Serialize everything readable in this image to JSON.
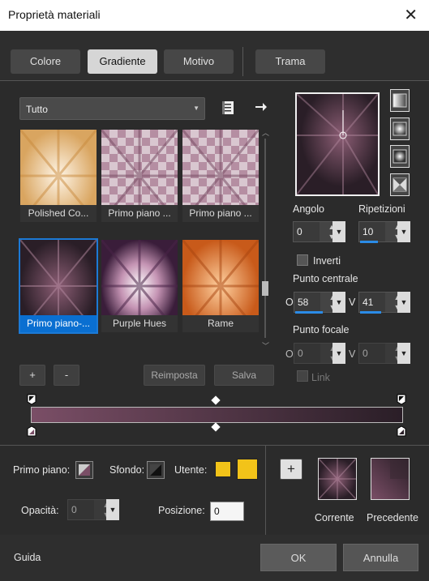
{
  "window": {
    "title": "Proprietà materiali",
    "close": "✕"
  },
  "tabs": [
    {
      "label": "Colore"
    },
    {
      "label": "Gradiente"
    },
    {
      "label": "Motivo"
    },
    {
      "label": "Trama"
    }
  ],
  "filter": {
    "value": "Tutto"
  },
  "gradients": [
    {
      "label": "Polished Co..."
    },
    {
      "label": "Primo piano ..."
    },
    {
      "label": "Primo piano ..."
    },
    {
      "label": "Primo piano-..."
    },
    {
      "label": "Purple Hues"
    },
    {
      "label": "Rame"
    }
  ],
  "buttons": {
    "add": "+",
    "remove": "-",
    "reset": "Reimposta",
    "save": "Salva",
    "add_swatch": "+"
  },
  "params": {
    "angle_label": "Angolo",
    "angle": "0",
    "repeat_label": "Ripetizioni",
    "repeat": "10",
    "invert_label": "Inverti",
    "center_label": "Punto centrale",
    "center_h_label": "O",
    "center_h": "58",
    "center_v_label": "V",
    "center_v": "41",
    "focal_label": "Punto focale",
    "focal_h_label": "O",
    "focal_h": "0",
    "focal_v_label": "V",
    "focal_v": "0",
    "link_label": "Link"
  },
  "bottom": {
    "fg_label": "Primo piano:",
    "bg_label": "Sfondo:",
    "user_label": "Utente:",
    "opacity_label": "Opacità:",
    "opacity": "0",
    "position_label": "Posizione:",
    "position": "0",
    "current_label": "Corrente",
    "previous_label": "Precedente"
  },
  "footer": {
    "help": "Guida",
    "ok": "OK",
    "cancel": "Annulla"
  },
  "colors": {
    "accent": "#2b8be6",
    "user_color": "#f2c319",
    "gradient_start": "#7a4e66",
    "gradient_end": "#2a1e27"
  }
}
